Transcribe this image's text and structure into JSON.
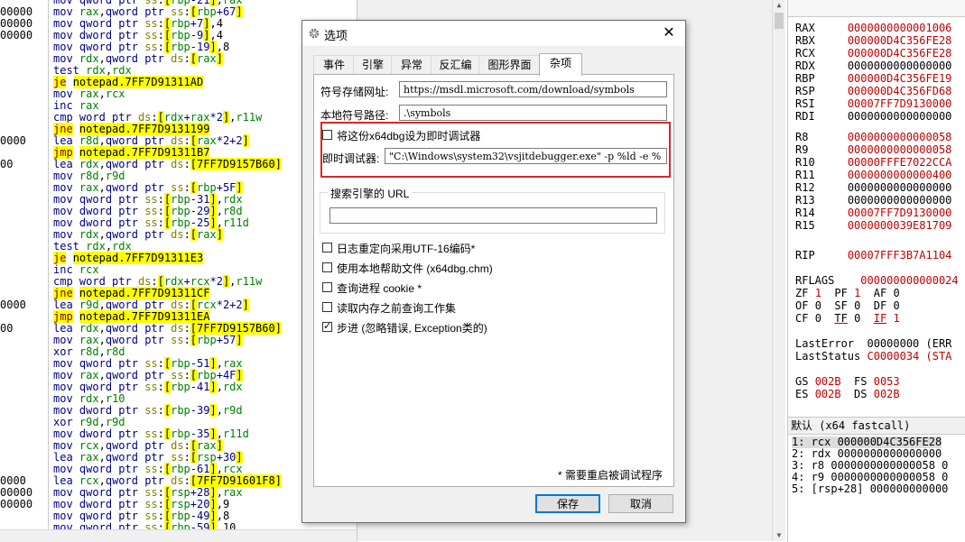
{
  "disasm": {
    "addresses": [
      "",
      "00000",
      "00000",
      "00000",
      "",
      "",
      "",
      "",
      "",
      "",
      "",
      "",
      "0000",
      "",
      "00",
      "",
      "",
      "",
      "",
      "",
      "",
      "",
      "",
      "",
      "",
      "",
      "0000",
      "",
      "00",
      "",
      "",
      "",
      "",
      "",
      "",
      "",
      "",
      "",
      "",
      "",
      "",
      "0000",
      "00000",
      "00000",
      ""
    ],
    "lines": [
      "mov qword ptr ss:[rbp-21],rax",
      "mov rax,qword ptr ss:[rbp+67]",
      "mov qword ptr ss:[rbp+7],4",
      "mov dword ptr ss:[rbp-9],4",
      "mov qword ptr ss:[rbp-19],8",
      "mov rdx,qword ptr ds:[rax]",
      "test rdx,rdx",
      "je notepad.7FF7D91311AD",
      "mov rax,rcx",
      "inc rax",
      "cmp word ptr ds:[rdx+rax*2],r11w",
      "jne notepad.7FF7D9131199",
      "lea r8d,qword ptr ds:[rax*2+2]",
      "jmp notepad.7FF7D91311B7",
      "lea rdx,qword ptr ds:[7FF7D9157B60]",
      "mov r8d,r9d",
      "mov rax,qword ptr ss:[rbp+5F]",
      "mov qword ptr ss:[rbp-31],rdx",
      "mov dword ptr ss:[rbp-29],r8d",
      "mov dword ptr ss:[rbp-25],r11d",
      "mov rdx,qword ptr ds:[rax]",
      "test rdx,rdx",
      "je notepad.7FF7D91311E3",
      "inc rcx",
      "cmp word ptr ds:[rdx+rcx*2],r11w",
      "jne notepad.7FF7D91311CF",
      "lea r9d,qword ptr ds:[rcx*2+2]",
      "jmp notepad.7FF7D91311EA",
      "lea rdx,qword ptr ds:[7FF7D9157B60]",
      "mov rax,qword ptr ss:[rbp+57]",
      "xor r8d,r8d",
      "mov qword ptr ss:[rbp-51],rax",
      "mov rax,qword ptr ss:[rbp+4F]",
      "mov qword ptr ss:[rbp-41],rdx",
      "mov rdx,r10",
      "mov dword ptr ss:[rbp-39],r9d",
      "xor r9d,r9d",
      "mov dword ptr ss:[rbp-35],r11d",
      "mov rcx,qword ptr ds:[rax]",
      "lea rax,qword ptr ss:[rsp+30]",
      "mov qword ptr ss:[rbp-61],rcx",
      "lea rcx,qword ptr ds:[7FF7D91601F8]",
      "mov qword ptr ss:[rsp+28],rax",
      "mov dword ptr ss:[rsp+20],9",
      "mov qword ptr ss:[rbp-49],8",
      "mov qword ptr ss:[rbp-59],10"
    ]
  },
  "registers": {
    "gp": [
      {
        "name": "RAX",
        "value": "0000000000001006",
        "changed": true
      },
      {
        "name": "RBX",
        "value": "000000D4C356FE28",
        "changed": true
      },
      {
        "name": "RCX",
        "value": "000000D4C356FE28",
        "changed": true
      },
      {
        "name": "RDX",
        "value": "0000000000000000",
        "changed": false
      },
      {
        "name": "RBP",
        "value": "000000D4C356FE19",
        "changed": true
      },
      {
        "name": "RSP",
        "value": "000000D4C356FD68",
        "changed": true
      },
      {
        "name": "RSI",
        "value": "00007FF7D9130000",
        "changed": true
      },
      {
        "name": "RDI",
        "value": "0000000000000000",
        "changed": false
      }
    ],
    "ext": [
      {
        "name": "R8",
        "value": "0000000000000058",
        "changed": true
      },
      {
        "name": "R9",
        "value": "0000000000000058",
        "changed": true
      },
      {
        "name": "R10",
        "value": "00000FFFE7022CCA",
        "changed": true
      },
      {
        "name": "R11",
        "value": "0000000000000400",
        "changed": true
      },
      {
        "name": "R12",
        "value": "0000000000000000",
        "changed": false
      },
      {
        "name": "R13",
        "value": "0000000000000000",
        "changed": false
      },
      {
        "name": "R14",
        "value": "00007FF7D9130000",
        "changed": true
      },
      {
        "name": "R15",
        "value": "0000000039E81709",
        "changed": true
      }
    ],
    "rip": {
      "name": "RIP",
      "value": "00007FFF3B7A1104"
    },
    "rflags": {
      "name": "RFLAGS",
      "value": "000000000000024"
    },
    "flags": [
      [
        "ZF",
        "1",
        "PF",
        "1",
        "AF",
        "0"
      ],
      [
        "OF",
        "0",
        "SF",
        "0",
        "DF",
        "0"
      ],
      [
        "CF",
        "0",
        "TF",
        "0",
        "IF",
        "1"
      ]
    ],
    "lasterror": {
      "name": "LastError",
      "value": "00000000 (ERR"
    },
    "laststatus": {
      "name": "LastStatus",
      "value": "C0000034 (STA"
    },
    "segs": [
      [
        "GS",
        "002B",
        "FS",
        "0053"
      ],
      [
        "ES",
        "002B",
        "DS",
        "002B"
      ]
    ]
  },
  "callstack": {
    "header": "默认 (x64 fastcall)",
    "rows": [
      "1: rcx 000000D4C356FE28",
      "2: rdx 0000000000000000",
      "3: r8 0000000000000058 0",
      "4: r9 0000000000000058 0",
      "5: [rsp+28] 000000000000"
    ]
  },
  "dialog": {
    "title": "选项",
    "close_glyph": "✕",
    "tabs": [
      "事件",
      "引擎",
      "异常",
      "反汇编",
      "图形界面",
      "杂项"
    ],
    "active_tab": 5,
    "symbol_store_label": "符号存储网址:",
    "symbol_store_value": "https://msdl.microsoft.com/download/symbols",
    "symbol_path_label": "本地符号路径:",
    "symbol_path_value": ".\\symbols",
    "jit_checkbox_label": "将这份x64dbg设为即时调试器",
    "jit_checkbox_checked": false,
    "jit_label": "即时调试器:",
    "jit_value": "\"C:\\Windows\\system32\\vsjitdebugger.exe\" -p %ld -e %",
    "search_engine_label": "搜索引擎的 URL",
    "search_engine_value": "",
    "options": [
      {
        "label": "日志重定向采用UTF-16编码*",
        "checked": false
      },
      {
        "label": "使用本地帮助文件 (x64dbg.chm)",
        "checked": false
      },
      {
        "label": "查询进程 cookie *",
        "checked": false
      },
      {
        "label": "读取内存之前查询工作集",
        "checked": false
      },
      {
        "label": "步进 (忽略错误, Exception类的)",
        "checked": true
      }
    ],
    "restart_note": "* 需要重启被调试程序",
    "save_label": "保存",
    "cancel_label": "取消"
  },
  "colors": {
    "highlight_box": "#d9262b",
    "jump_highlight": "#ffff00",
    "changed_register": "#c00000"
  }
}
